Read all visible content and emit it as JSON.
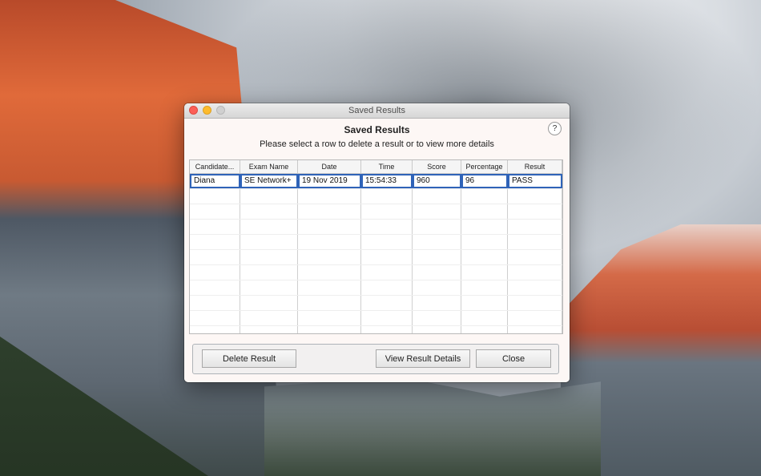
{
  "window": {
    "title": "Saved Results",
    "heading": "Saved Results",
    "subheading": "Please select a row to delete a result or to view more details",
    "help_label": "?"
  },
  "table": {
    "columns": [
      "Candidate...",
      "Exam Name",
      "Date",
      "Time",
      "Score",
      "Percentage",
      "Result"
    ],
    "rows": [
      [
        "Diana",
        "SE Network+",
        "19 Nov 2019",
        "15:54:33",
        "960",
        "96",
        "PASS"
      ]
    ]
  },
  "buttons": {
    "delete": "Delete Result",
    "details": "View Result Details",
    "close": "Close"
  },
  "colors": {
    "selection_border": "#2f63b8",
    "close_dot": "#fc5f57",
    "minimize_dot": "#fdbb2d",
    "zoom_dot": "#d0d0d0"
  }
}
